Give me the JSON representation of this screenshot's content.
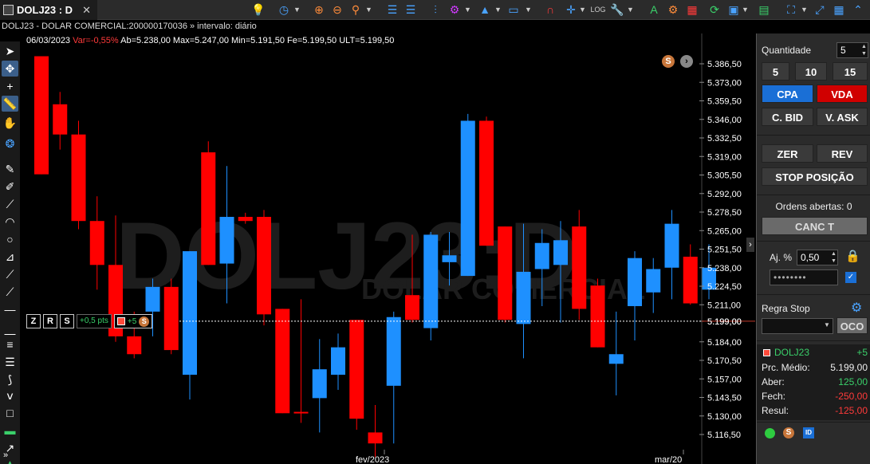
{
  "tab": {
    "title": "DOLJ23 : D",
    "close": "✕"
  },
  "info": {
    "title_line": "DOLJ23 - DOLAR COMERCIAL:200000170036 » intervalo: diário",
    "date": "06/03/2023",
    "var": "Var=-0,55%",
    "ab": "Ab=5.238,00",
    "max": "Max=5.247,00",
    "min": "Min=5.191,50",
    "fe": "Fe=5.199,50",
    "ult": "ULT=5.199,50"
  },
  "watermark": {
    "symbol": "DOLJ23:D",
    "name": "DOLAR COMERCIAL"
  },
  "position_bar": {
    "z": "Z",
    "r": "R",
    "s": "S",
    "pts": "+0,5 pts",
    "qty": "+5",
    "coin": "S"
  },
  "chart_data": {
    "type": "candlestick",
    "y_ticks": [
      "5.386,50",
      "5.373,00",
      "5.359,50",
      "5.346,00",
      "5.332,50",
      "5.319,00",
      "5.305,50",
      "5.292,00",
      "5.278,50",
      "5.265,00",
      "5.251,50",
      "5.238,00",
      "5.224,50",
      "5.211,00",
      "5.199,00",
      "5.184,00",
      "5.170,50",
      "5.157,00",
      "5.143,50",
      "5.130,00",
      "5.116,50"
    ],
    "ylim": [
      5112,
      5392
    ],
    "x_labels": [
      "fev/2023",
      "mar/20"
    ],
    "last_price": "5.199,00",
    "candles": [
      {
        "o": 5392,
        "h": 5392,
        "l": 5306,
        "c": 5306
      },
      {
        "o": 5357,
        "h": 5366,
        "l": 5324,
        "c": 5335
      },
      {
        "o": 5335,
        "h": 5345,
        "l": 5266,
        "c": 5272
      },
      {
        "o": 5272,
        "h": 5290,
        "l": 5222,
        "c": 5240
      },
      {
        "o": 5240,
        "h": 5276,
        "l": 5184,
        "c": 5188
      },
      {
        "o": 5188,
        "h": 5206,
        "l": 5172,
        "c": 5175
      },
      {
        "o": 5206,
        "h": 5230,
        "l": 5188,
        "c": 5224
      },
      {
        "o": 5224,
        "h": 5230,
        "l": 5175,
        "c": 5178
      },
      {
        "o": 5160,
        "h": 5250,
        "l": 5142,
        "c": 5250
      },
      {
        "o": 5322,
        "h": 5330,
        "l": 5240,
        "c": 5240
      },
      {
        "o": 5241,
        "h": 5312,
        "l": 5212,
        "c": 5275
      },
      {
        "o": 5275,
        "h": 5278,
        "l": 5270,
        "c": 5272
      },
      {
        "o": 5275,
        "h": 5280,
        "l": 5196,
        "c": 5204
      },
      {
        "o": 5208,
        "h": 5208,
        "l": 5132,
        "c": 5132
      },
      {
        "o": 5133,
        "h": 5215,
        "l": 5125,
        "c": 5132
      },
      {
        "o": 5143,
        "h": 5186,
        "l": 5118,
        "c": 5164
      },
      {
        "o": 5160,
        "h": 5190,
        "l": 5149,
        "c": 5180
      },
      {
        "o": 5200,
        "h": 5200,
        "l": 5120,
        "c": 5128
      },
      {
        "o": 5118,
        "h": 5138,
        "l": 5100,
        "c": 5110
      },
      {
        "o": 5152,
        "h": 5206,
        "l": 5110,
        "c": 5202
      },
      {
        "o": 5218,
        "h": 5262,
        "l": 5198,
        "c": 5200
      },
      {
        "o": 5194,
        "h": 5264,
        "l": 5185,
        "c": 5262
      },
      {
        "o": 5242,
        "h": 5264,
        "l": 5225,
        "c": 5247
      },
      {
        "o": 5232,
        "h": 5350,
        "l": 5232,
        "c": 5345
      },
      {
        "o": 5345,
        "h": 5348,
        "l": 5254,
        "c": 5254
      },
      {
        "o": 5268,
        "h": 5268,
        "l": 5198,
        "c": 5200
      },
      {
        "o": 5197,
        "h": 5270,
        "l": 5172,
        "c": 5235
      },
      {
        "o": 5237,
        "h": 5266,
        "l": 5210,
        "c": 5256
      },
      {
        "o": 5240,
        "h": 5272,
        "l": 5198,
        "c": 5258
      },
      {
        "o": 5268,
        "h": 5280,
        "l": 5200,
        "c": 5208
      },
      {
        "o": 5225,
        "h": 5230,
        "l": 5180,
        "c": 5180
      },
      {
        "o": 5168,
        "h": 5206,
        "l": 5145,
        "c": 5175
      },
      {
        "o": 5210,
        "h": 5250,
        "l": 5185,
        "c": 5245
      },
      {
        "o": 5220,
        "h": 5245,
        "l": 5205,
        "c": 5237
      },
      {
        "o": 5238,
        "h": 5280,
        "l": 5215,
        "c": 5270
      },
      {
        "o": 5246,
        "h": 5255,
        "l": 5211,
        "c": 5212
      },
      {
        "o": 5222,
        "h": 5255,
        "l": 5215,
        "c": 5238
      }
    ]
  },
  "panel": {
    "quantidade_label": "Quantidade",
    "quantidade_value": "5",
    "q5": "5",
    "q10": "10",
    "q15": "15",
    "cpa": "CPA",
    "vda": "VDA",
    "cbid": "C. BID",
    "vask": "V. ASK",
    "zer": "ZER",
    "rev": "REV",
    "stop": "STOP POSIÇÃO",
    "ordens": "Ordens abertas: 0",
    "canc": "CANC T",
    "aj_label": "Aj. %",
    "aj_value": "0,50",
    "password": "••••••••",
    "regra_label": "Regra Stop",
    "oco": "OCO",
    "pos_symbol": "DOLJ23",
    "pos_qty": "+5",
    "prc_label": "Prc. Médio:",
    "prc_value": "5.199,00",
    "aber_label": "Aber:",
    "aber_value": "125,00",
    "fech_label": "Fech:",
    "fech_value": "-250,00",
    "resul_label": "Resul:",
    "resul_value": "-125,00",
    "coin": "S",
    "id": "ID"
  },
  "colors": {
    "up": "#1e90ff",
    "down": "#ff0000",
    "buy": "#1a6fd6",
    "sell": "#d00000"
  }
}
